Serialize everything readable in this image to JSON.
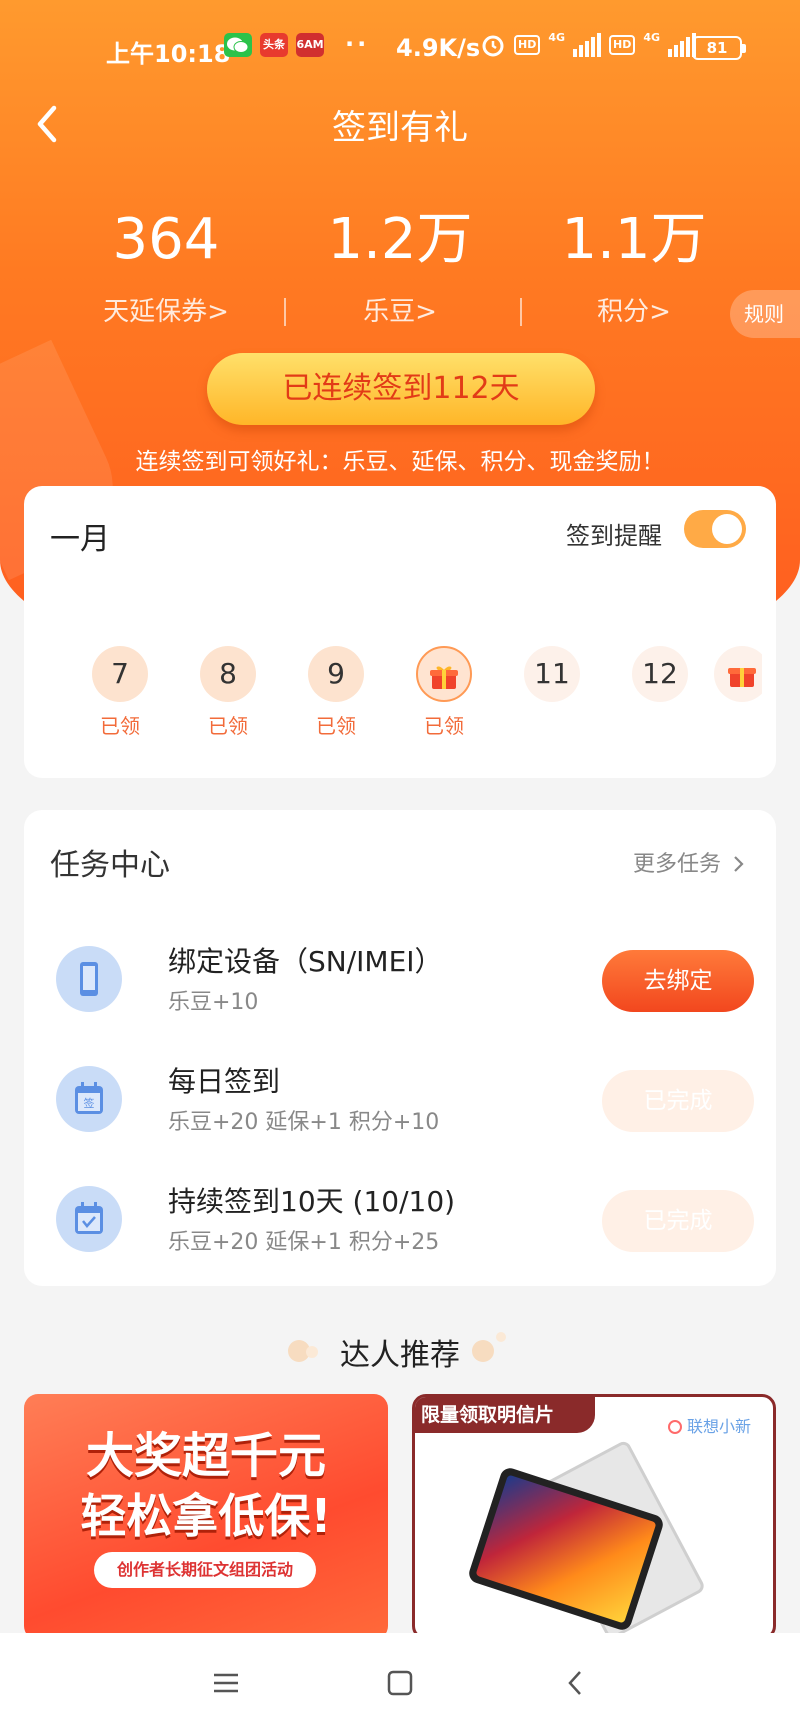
{
  "status_bar": {
    "time": "上午10:18",
    "apps": [
      {
        "name": "wechat",
        "label": "",
        "color": "#2bc24a"
      },
      {
        "name": "toutiao",
        "label": "头条",
        "color": "#e83a2e"
      },
      {
        "name": "app",
        "label": "6AM",
        "color": "#d12f2f"
      }
    ],
    "dots": "··",
    "speed": "4.9K/s",
    "network1": "4G",
    "network2": "4G",
    "hd": "HD",
    "battery": "81"
  },
  "header": {
    "title": "签到有礼"
  },
  "stats": [
    {
      "value": "364",
      "label": "天延保券>"
    },
    {
      "value": "1.2万",
      "label": "乐豆>"
    },
    {
      "value": "1.1万",
      "label": "积分>"
    }
  ],
  "rules_label": "规则",
  "streak_label": "已连续签到112天",
  "hint": "连续签到可领好礼：乐豆、延保、积分、现金奖励！",
  "calendar": {
    "month": "一月",
    "reminder_label": "签到提醒",
    "reminder_on": true,
    "days": [
      {
        "day": "7",
        "status": "已领",
        "type": "past"
      },
      {
        "day": "8",
        "status": "已领",
        "type": "past"
      },
      {
        "day": "9",
        "status": "已领",
        "type": "past"
      },
      {
        "day": "",
        "status": "已领",
        "type": "gift"
      },
      {
        "day": "11",
        "status": "",
        "type": "future"
      },
      {
        "day": "12",
        "status": "",
        "type": "future"
      },
      {
        "day": "",
        "status": "",
        "type": "gift-future"
      }
    ]
  },
  "tasks": {
    "title": "任务中心",
    "more": "更多任务",
    "items": [
      {
        "name": "绑定设备（SN/IMEI）",
        "reward": "乐豆+10",
        "button": "去绑定",
        "state": "active",
        "icon": "phone-icon"
      },
      {
        "name": "每日签到",
        "reward": "乐豆+20 延保+1 积分+10",
        "button": "已完成",
        "state": "done",
        "icon": "calendar-sign-icon"
      },
      {
        "name": "持续签到10天 (10/10)",
        "reward": "乐豆+20 延保+1 积分+25",
        "button": "已完成",
        "state": "done",
        "icon": "calendar-check-icon"
      }
    ]
  },
  "recommend": {
    "title": "达人推荐",
    "banner_a": {
      "line1": "大奖超千元",
      "line2": "轻松拿低保!",
      "tag": "创作者长期征文组团活动"
    },
    "banner_b": {
      "ribbon": "限量领取明信片",
      "brand": "联想小新"
    }
  },
  "colors": {
    "accent": "#ff6a22",
    "button_gold": "#ffc83a",
    "text_orange": "#f26b3a"
  }
}
